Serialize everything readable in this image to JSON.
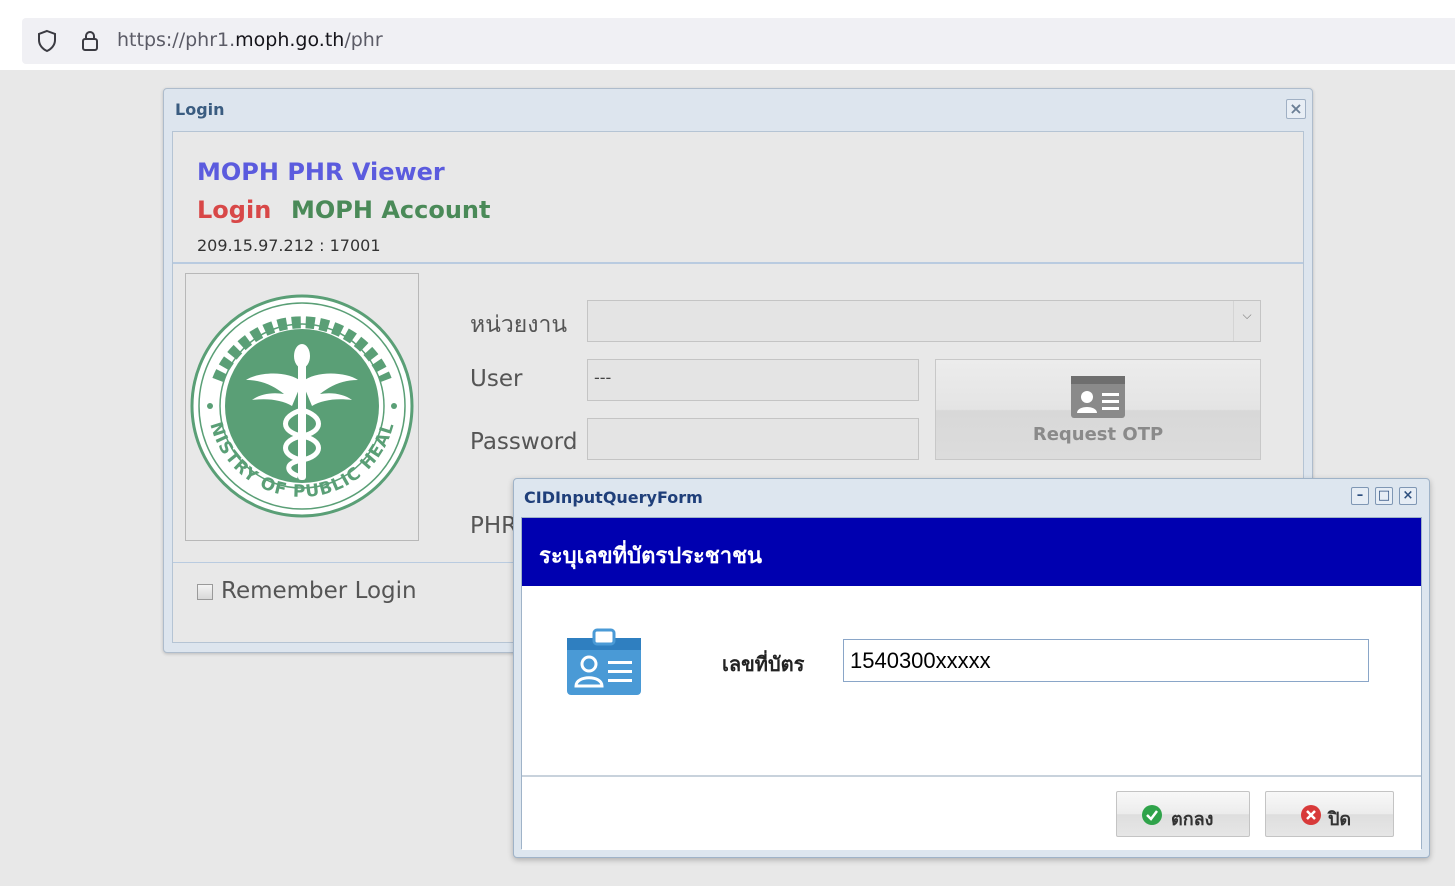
{
  "browser": {
    "url_prefix": "https://phr1.",
    "url_host": "moph.go.th",
    "url_path": "/phr"
  },
  "login_window": {
    "title": "Login",
    "app_title": "MOPH PHR Viewer",
    "login_label": "Login",
    "account_label": "MOPH Account",
    "server_address": "209.15.97.212 : 17001",
    "fields": {
      "agency_label": "หน่วยงาน",
      "agency_value": "",
      "user_label": "User",
      "user_value": "---",
      "password_label": "Password",
      "password_value": "",
      "phr_label": "PHR"
    },
    "request_otp_label": "Request OTP",
    "remember_label": "Remember Login",
    "logo_icon": "moph-seal-icon",
    "colors": {
      "app_title": "#5b5bde",
      "login": "#d84848",
      "account": "#4a8a58"
    }
  },
  "cid_dialog": {
    "title": "CIDInputQueryForm",
    "banner_text": "ระบุเลขที่บัตรประชาชน",
    "id_label": "เลขที่บัตร",
    "id_value": "1540300xxxxx",
    "ok_label": "ตกลง",
    "close_label": "ปิด",
    "banner_color": "#0000b0",
    "icons": [
      "id-card-icon",
      "check-icon",
      "cancel-icon",
      "minimize-icon",
      "maximize-icon",
      "close-icon"
    ]
  }
}
